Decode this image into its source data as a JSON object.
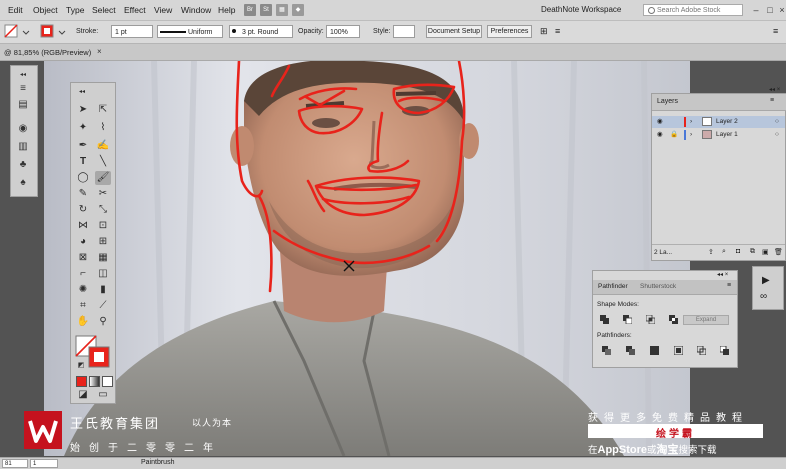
{
  "menu": {
    "items": [
      "Edit",
      "Object",
      "Type",
      "Select",
      "Effect",
      "View",
      "Window",
      "Help"
    ],
    "bridge_icon": "Br",
    "stock_icon": "St",
    "workspace": "DeathNote Workspace",
    "search_placeholder": "Search Adobe Stock"
  },
  "control": {
    "stroke_label": "Stroke:",
    "stroke_weight": "1 pt",
    "stroke_profile": "Uniform",
    "brush": "3 pt. Round",
    "opacity_label": "Opacity:",
    "opacity": "100%",
    "style_label": "Style:",
    "document_setup": "Document Setup",
    "preferences": "Preferences"
  },
  "document": {
    "tab": "@ 81,85% (RGB/Preview)",
    "close": "×"
  },
  "layers": {
    "title": "Layers",
    "rows": [
      {
        "name": "Layer 2",
        "selected": true
      },
      {
        "name": "Layer 1",
        "selected": false
      }
    ],
    "count": "2 La..."
  },
  "pathfinder": {
    "tabs": [
      "Pathfinder",
      "Shutterstock"
    ],
    "shape_modes": "Shape Modes:",
    "pathfinders": "Pathfinders:",
    "expand": "Expand"
  },
  "watermark": {
    "name": "王氏教育集团",
    "slogan": "以人为本",
    "sub": "始创于二零零二年",
    "promo_line1": "获得更多免费精品教程",
    "promo_badge": "绘学霸",
    "promo_line3_prefix": "在",
    "promo_line3_store": "AppStore",
    "promo_line3_mid": "或",
    "promo_line3_taobao": "淘宝",
    "promo_line3_suffix": "搜索下载"
  },
  "status": {
    "zoom": "81",
    "page": "1",
    "tool": "Paintbrush"
  },
  "colors": {
    "accent_red": "#e8231b",
    "brand_red": "#c5121e"
  }
}
